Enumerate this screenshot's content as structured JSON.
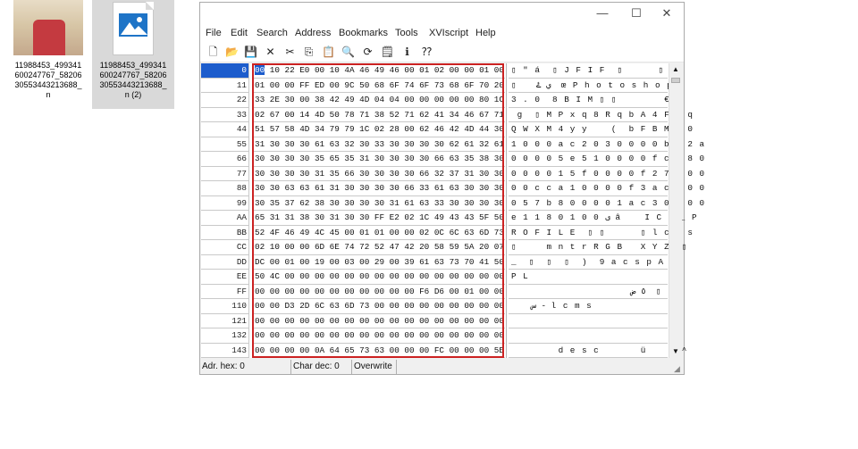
{
  "desktop": {
    "files": [
      {
        "label": "11988453_499341\n600247767_58206\n30553443213688_\nn",
        "icon": "photo-thumbnail"
      },
      {
        "label": "11988453_499341\n600247767_58206\n30553443213688_\nn (2)",
        "icon": "image-file-icon"
      }
    ]
  },
  "window": {
    "controls": {
      "minimize": "—",
      "maximize": "☐",
      "close": "✕"
    },
    "menu": [
      "File",
      "Edit",
      "Search",
      "Address",
      "Bookmarks",
      "Tools",
      "XVIscript",
      "Help"
    ],
    "toolbar": [
      {
        "name": "new-icon",
        "glyph": "🗋"
      },
      {
        "name": "open-icon",
        "glyph": "📂"
      },
      {
        "name": "save-icon",
        "glyph": "💾"
      },
      {
        "name": "close-file-icon",
        "glyph": "✕"
      },
      {
        "name": "cut-icon",
        "glyph": "✂"
      },
      {
        "name": "copy-icon",
        "glyph": "⎘"
      },
      {
        "name": "paste-icon",
        "glyph": "📋"
      },
      {
        "name": "find-icon",
        "glyph": "🔍"
      },
      {
        "name": "replace-icon",
        "glyph": "⟳"
      },
      {
        "name": "properties-icon",
        "glyph": "🗒"
      },
      {
        "name": "script-icon",
        "glyph": "ℹ"
      },
      {
        "name": "help-pointer-icon",
        "glyph": "⁇"
      }
    ],
    "rows": [
      {
        "addr": "0",
        "hex": "00 10 22 E0 00 10 4A 46 49 46 00 01 02 00 00 01 00",
        "chars": "▯ \" á  ▯ J F I F  ▯      ▯"
      },
      {
        "addr": "11",
        "hex": "01 00 00 FF ED 00 9C 50 68 6F 74 6F 73 68 6F 70 20",
        "chars": "▯    ي ۓ  œ P h o t o s h o p"
      },
      {
        "addr": "22",
        "hex": "33 2E 30 00 38 42 49 4D 04 04 00 00 00 00 00 80 1C",
        "chars": "3 . 0  8 B I M ▯ ▯        €"
      },
      {
        "addr": "33",
        "hex": "02 67 00 14 4D 50 78 71 38 52 71 62 41 34 46 67 71",
        "chars": " g  ▯ M P x q 8 R q b A 4 F g q"
      },
      {
        "addr": "44",
        "hex": "51 57 58 4D 34 79 79 1C 02 28 00 62 46 42 4D 44 30",
        "chars": "Q W X M 4 y y    (  b F B M D 0"
      },
      {
        "addr": "55",
        "hex": "31 30 30 30 61 63 32 30 33 30 30 30 30 62 61 32 61",
        "chars": "1 0 0 0 a c 2 0 3 0 0 0 0 b a 2 a"
      },
      {
        "addr": "66",
        "hex": "30 30 30 30 35 65 35 31 30 30 30 30 66 63 35 38 30",
        "chars": "0 0 0 0 5 e 5 1 0 0 0 0 f c 5 8 0"
      },
      {
        "addr": "77",
        "hex": "30 30 30 30 31 35 66 30 30 30 30 66 32 37 31 30 30",
        "chars": "0 0 0 0 1 5 f 0 0 0 0 f 2 7 1 0 0"
      },
      {
        "addr": "88",
        "hex": "30 30 63 63 61 31 30 30 30 30 66 33 61 63 30 30 30",
        "chars": "0 0 c c a 1 0 0 0 0 f 3 a c 0 0 0"
      },
      {
        "addr": "99",
        "hex": "30 35 37 62 38 30 30 30 30 31 61 63 33 30 30 30 30",
        "chars": "0 5 7 b 8 0 0 0 0 1 a c 3 0 0 0 0"
      },
      {
        "addr": "AA",
        "hex": "65 31 31 38 30 31 30 30 FF E2 02 1C 49 43 43 5F 50",
        "chars": "e 1 1 8 0 1 0 0 ی â    I C C _ P"
      },
      {
        "addr": "BB",
        "hex": "52 4F 46 49 4C 45 00 01 01 00 00 02 0C 6C 63 6D 73",
        "chars": "R O F I L E  ▯ ▯      ▯ l c m s"
      },
      {
        "addr": "CC",
        "hex": "02 10 00 00 6D 6E 74 72 52 47 42 20 58 59 5A 20 07",
        "chars": "▯     m n t r R G B   X Y Z  ▯"
      },
      {
        "addr": "DD",
        "hex": "DC 00 01 00 19 00 03 00 29 00 39 61 63 73 70 41 50",
        "chars": "_  ▯  ▯  ▯  )  9 a c s p A P"
      },
      {
        "addr": "EE",
        "hex": "50 4C 00 00 00 00 00 00 00 00 00 00 00 00 00 00 00",
        "chars": "P L"
      },
      {
        "addr": "FF",
        "hex": "00 00 00 00 00 00 00 00 00 00 00 F6 D6 00 01 00 00",
        "chars": "                        ٥ ض  ▯"
      },
      {
        "addr": "110",
        "hex": "00 00 D3 2D 6C 63 6D 73 00 00 00 00 00 00 00 00 00",
        "chars": "    س - l c m s"
      },
      {
        "addr": "121",
        "hex": "00 00 00 00 00 00 00 00 00 00 00 00 00 00 00 00 00",
        "chars": ""
      },
      {
        "addr": "132",
        "hex": "00 00 00 00 00 00 00 00 00 00 00 00 00 00 00 00 00",
        "chars": ""
      },
      {
        "addr": "143",
        "hex": "00 00 00 00 0A 64 65 73 63 00 00 00 FC 00 00 00 5E",
        "chars": "        d e s c       ü      ^"
      }
    ],
    "status": {
      "address": "Adr. hex: 0",
      "char": "Char dec: 0",
      "mode": "Overwrite"
    },
    "colors": {
      "selection": "#1c5ccc",
      "highlight_box": "#cc2222"
    }
  }
}
